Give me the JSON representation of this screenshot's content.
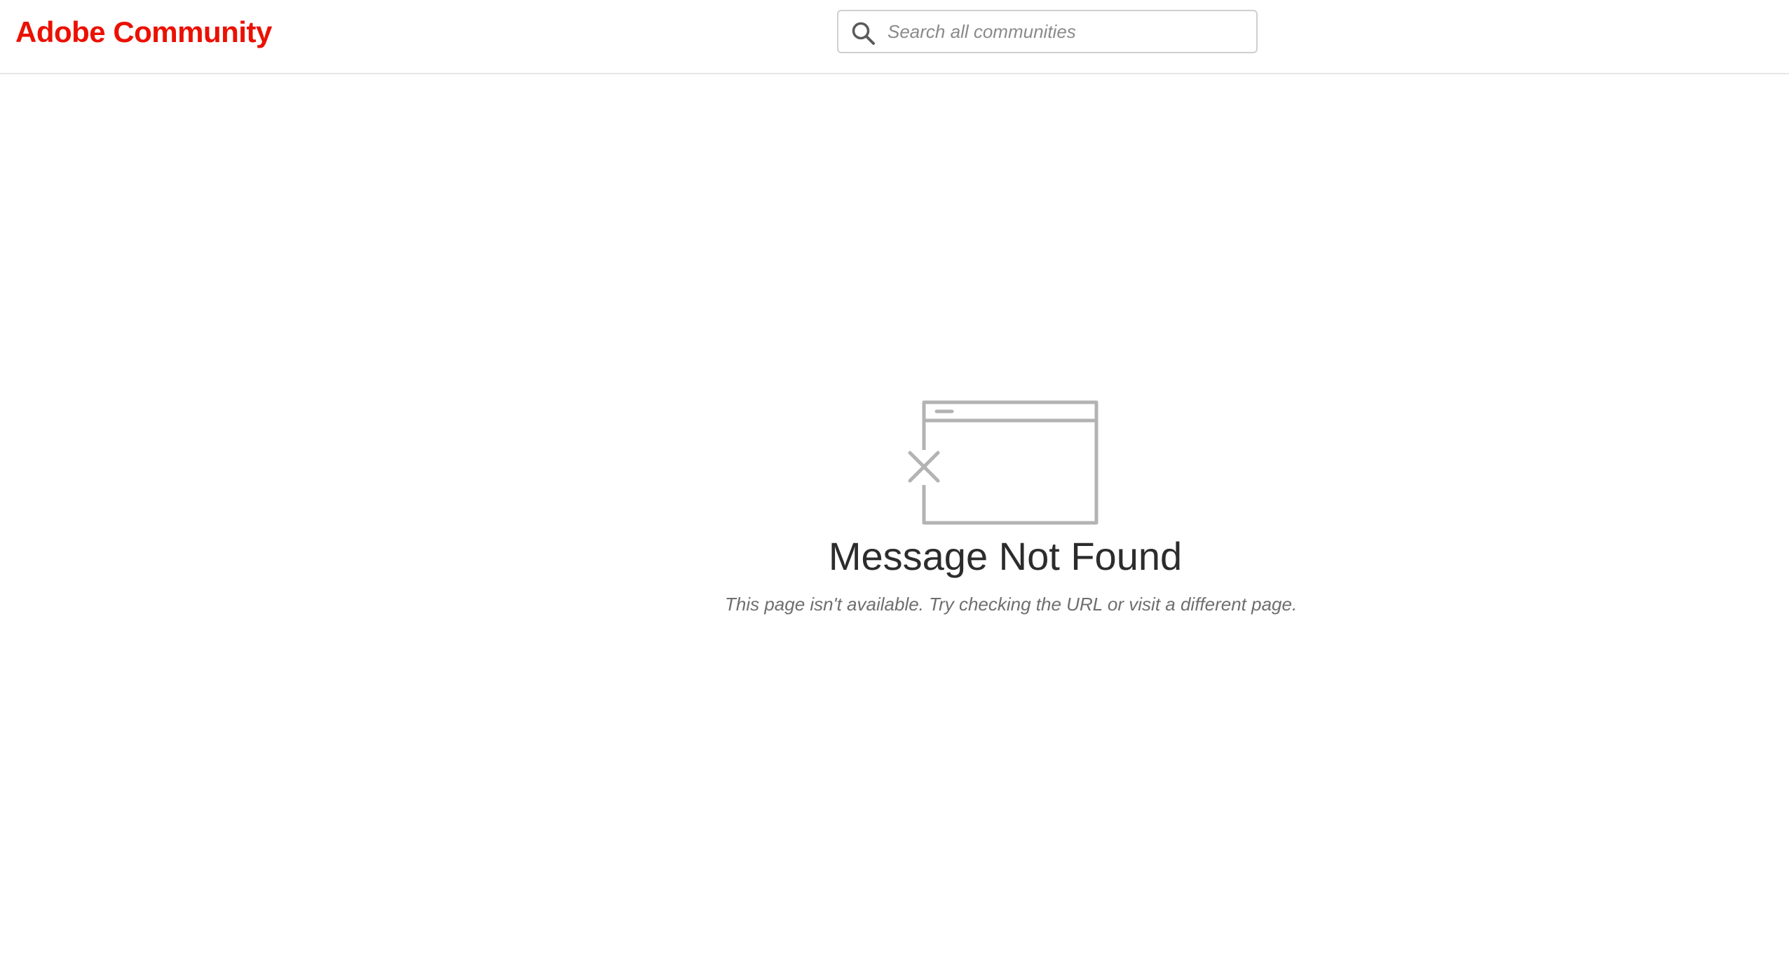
{
  "header": {
    "logo_text": "Adobe Community",
    "brand_color": "#eb1000",
    "search": {
      "placeholder": "Search all communities",
      "value": "",
      "icon": "search-icon"
    }
  },
  "main": {
    "illustration_icon": "browser-window-error-icon",
    "title": "Message Not Found",
    "subtitle": "This page isn't available. Try checking the URL or visit a different page."
  }
}
